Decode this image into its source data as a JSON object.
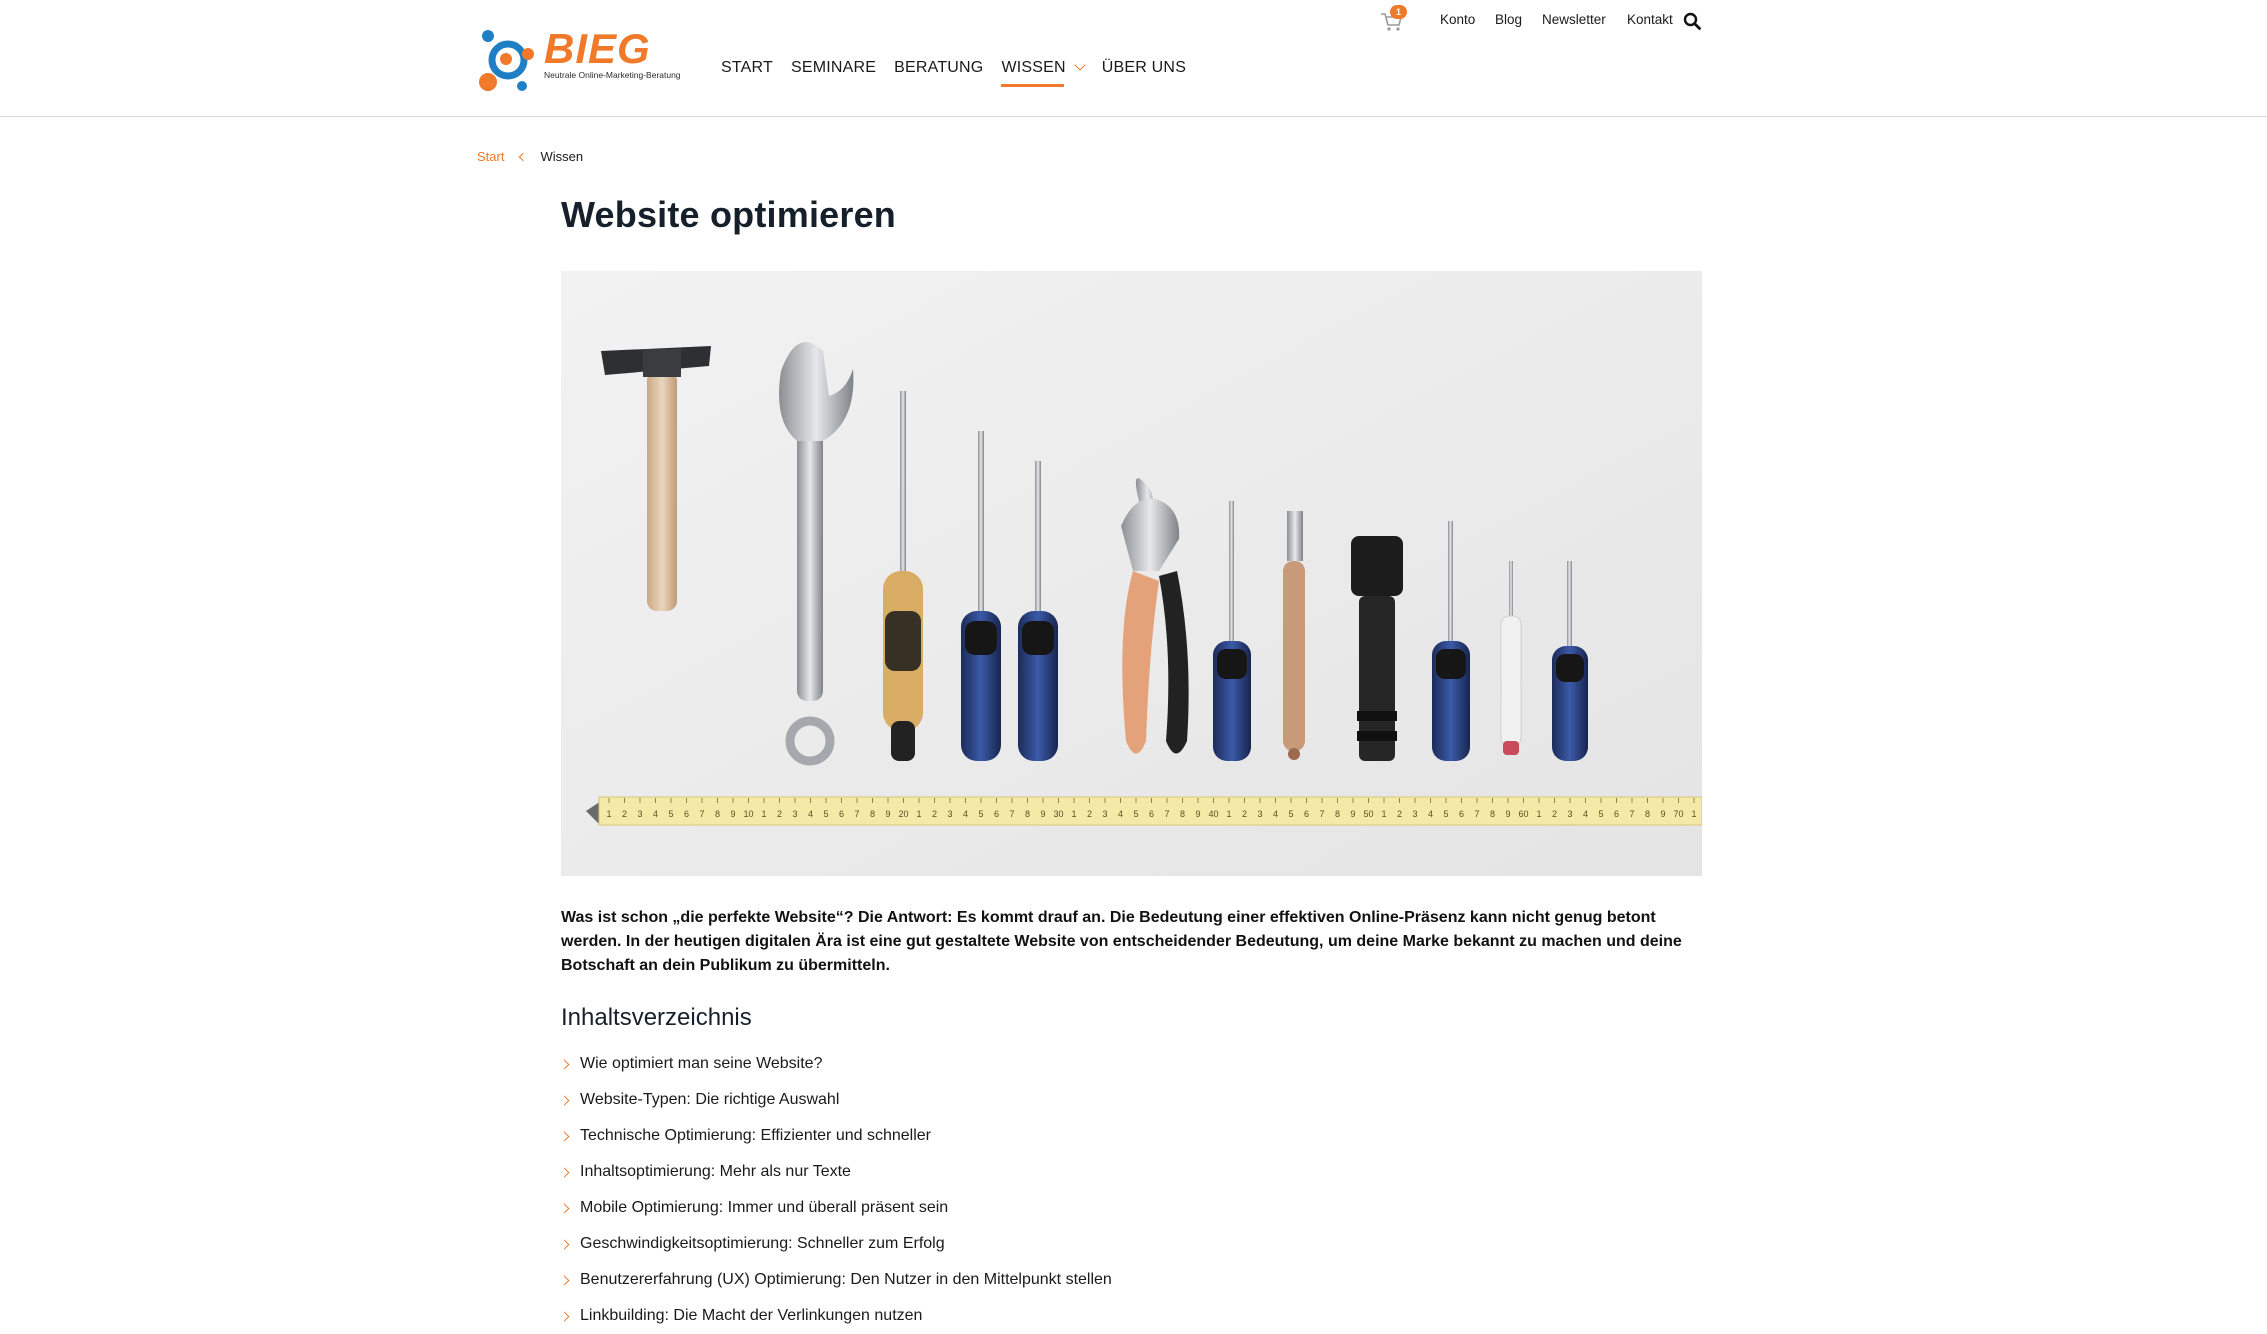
{
  "brand": {
    "name": "BIEG",
    "tagline": "Neutrale Online-Marketing-Beratung",
    "accent": "#f07a2a",
    "blue": "#1f7fc4"
  },
  "nav": {
    "items": [
      {
        "label": "START"
      },
      {
        "label": "SEMINARE"
      },
      {
        "label": "BERATUNG"
      },
      {
        "label": "WISSEN",
        "active": true
      },
      {
        "label": "ÜBER UNS"
      }
    ]
  },
  "topbar": {
    "cart_count": "1",
    "links": [
      "Konto",
      "Blog",
      "Newsletter",
      "Kontakt"
    ]
  },
  "breadcrumb": {
    "start": "Start",
    "current": "Wissen"
  },
  "page": {
    "title": "Website optimieren",
    "intro_bold": "Was ist schon „die perfekte Website“?",
    "intro_rest": " Die Antwort: Es kommt drauf an. Die Bedeutung einer effektiven Online-Präsenz kann nicht genug betont werden. In der heutigen digitalen Ära ist eine gut gestaltete Website von entscheidender Bedeutung, um deine Marke bekannt zu machen und deine Botschaft an dein Publikum zu übermitteln.",
    "toc_title": "Inhaltsverzeichnis",
    "toc": [
      "Wie optimiert man seine Website?",
      "Website-Typen: Die richtige Auswahl",
      "Technische Optimierung: Effizienter und schneller",
      "Inhaltsoptimierung: Mehr als nur Texte",
      "Mobile Optimierung: Immer und überall präsent sein",
      "Geschwindigkeitsoptimierung: Schneller zum Erfolg",
      "Benutzererfahrung (UX) Optimierung: Den Nutzer in den Mittelpunkt stellen",
      "Linkbuilding: Die Macht der Verlinkungen nutzen"
    ]
  },
  "hero": {
    "ruler_numbers": [
      "10",
      "20",
      "30",
      "40",
      "50",
      "60",
      "70"
    ]
  }
}
